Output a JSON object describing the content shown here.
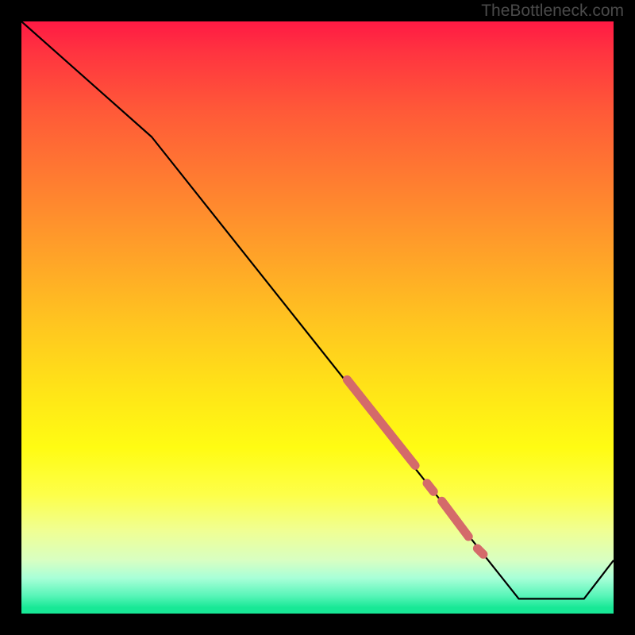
{
  "watermark": "TheBottleneck.com",
  "chart_data": {
    "type": "line",
    "title": "",
    "xlabel": "",
    "ylabel": "",
    "xlim": [
      0,
      100
    ],
    "ylim": [
      0,
      100
    ],
    "series": [
      {
        "name": "curve",
        "x": [
          0,
          22,
          84,
          95,
          100
        ],
        "values": [
          100,
          80.5,
          2.5,
          2.5,
          9
        ],
        "stroke": "#000000"
      }
    ],
    "highlighted_segments": [
      {
        "start_x": 55,
        "start_y": 39.5,
        "end_x": 66.5,
        "end_y": 25,
        "thick": true
      },
      {
        "start_x": 68.5,
        "start_y": 22,
        "end_x": 69.6,
        "end_y": 20.6,
        "thick": true
      },
      {
        "start_x": 71,
        "start_y": 19,
        "end_x": 75.5,
        "end_y": 13,
        "thick": true
      },
      {
        "start_x": 77,
        "start_y": 11,
        "end_x": 78,
        "end_y": 10,
        "thick": true
      }
    ],
    "highlight_color": "#d46a6a",
    "background_gradient": {
      "type": "vertical",
      "stops": [
        {
          "pos": 0,
          "color": "#ff1a44"
        },
        {
          "pos": 50,
          "color": "#ffc81f"
        },
        {
          "pos": 75,
          "color": "#fffc13"
        },
        {
          "pos": 100,
          "color": "#18e896"
        }
      ]
    }
  }
}
